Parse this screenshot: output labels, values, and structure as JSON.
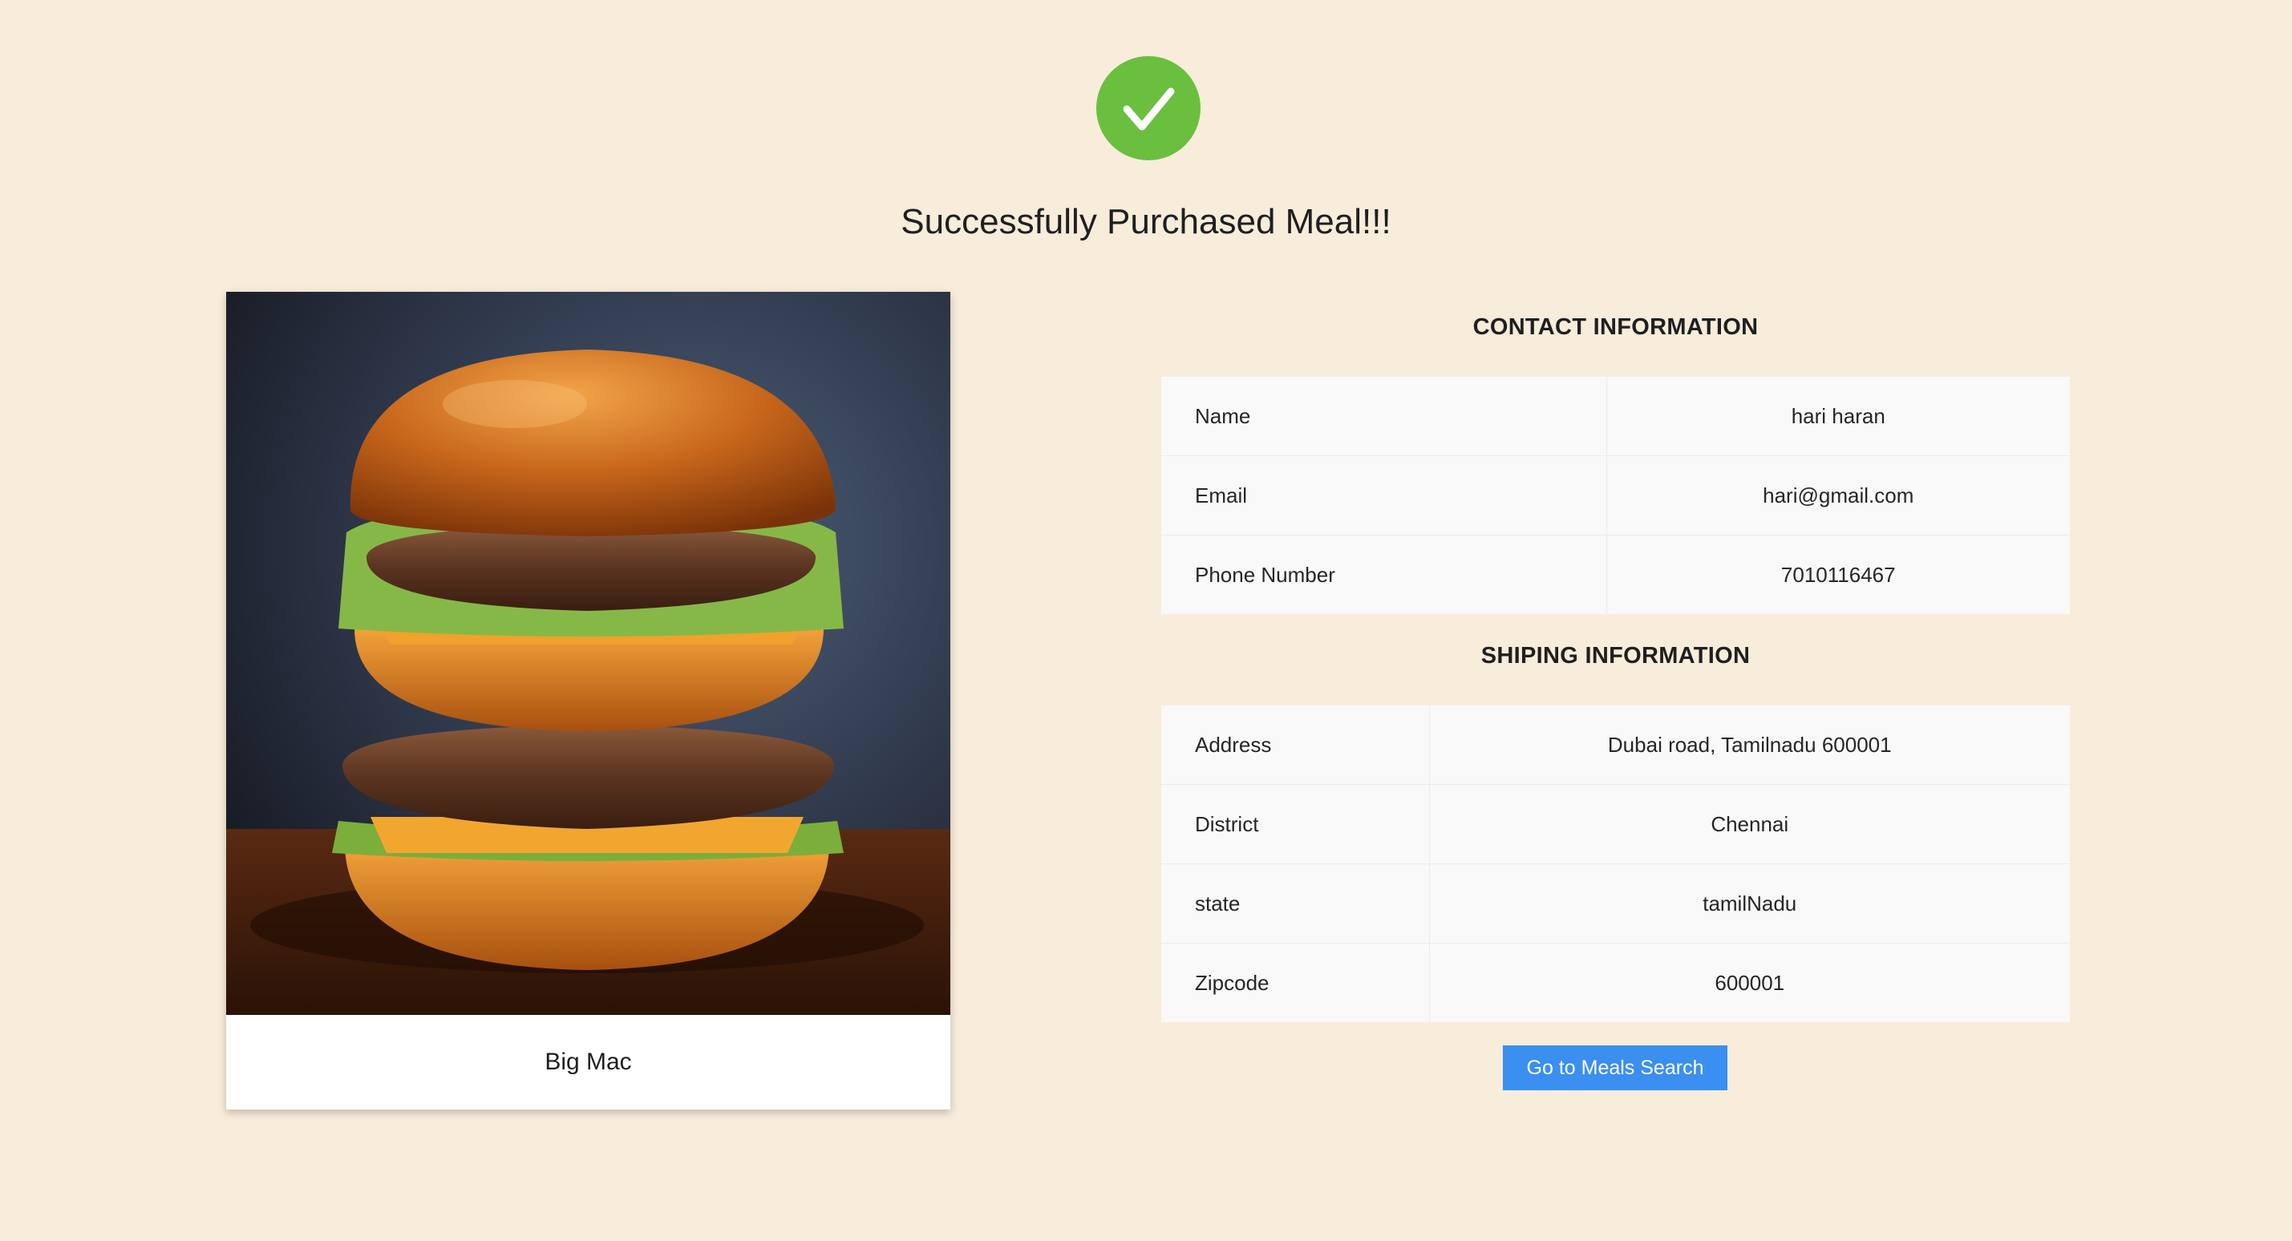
{
  "icons": {
    "success": "check-circle-icon"
  },
  "colors": {
    "background": "#f8ecdb",
    "success_green": "#6abf3f",
    "button_blue": "#3a8ff0"
  },
  "header": {
    "title": "Successfully Purchased Meal!!!"
  },
  "meal": {
    "name": "Big Mac"
  },
  "contact": {
    "heading": "CONTACT INFORMATION",
    "rows": [
      {
        "label": "Name",
        "value": "hari haran"
      },
      {
        "label": "Email",
        "value": "hari@gmail.com"
      },
      {
        "label": "Phone Number",
        "value": "7010116467"
      }
    ]
  },
  "shipping": {
    "heading": "SHIPING INFORMATION",
    "rows": [
      {
        "label": "Address",
        "value": "Dubai road, Tamilnadu 600001"
      },
      {
        "label": "District",
        "value": "Chennai"
      },
      {
        "label": "state",
        "value": "tamilNadu"
      },
      {
        "label": "Zipcode",
        "value": "600001"
      }
    ]
  },
  "actions": {
    "go_to_search_label": "Go to Meals Search"
  }
}
